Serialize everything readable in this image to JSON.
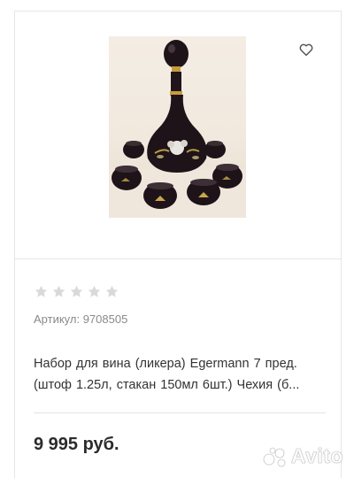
{
  "product": {
    "image_alt": "photo",
    "favorite_icon": "heart-outline-icon",
    "rating_stars": 5,
    "rating_filled": 0,
    "article": "Артикул: 9708505",
    "title_line1": "Набор для вина (ликера)  Egermann 7 пред.",
    "title_line2": "(штоф  1.25л, стакан 150мл 6шт.) Чехия (б...",
    "price": "9 995 руб."
  },
  "watermark": {
    "text": "Avito"
  },
  "colors": {
    "border": "#e6e6e6",
    "star_empty": "#d9d9d9",
    "muted_text": "#8a8a8a",
    "price_text": "#2b2b2b"
  }
}
